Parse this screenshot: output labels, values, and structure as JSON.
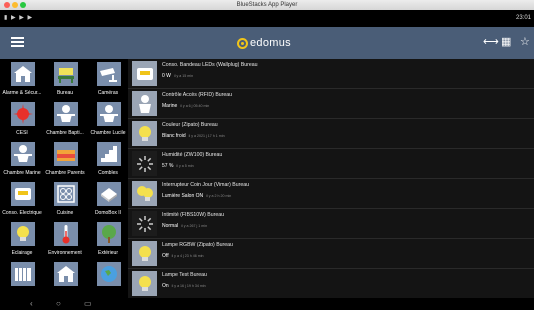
{
  "window": {
    "title": "BlueStacks App Player"
  },
  "status_bar": {
    "icons": "▮ ▶ ▶ ▶",
    "time": "23:01"
  },
  "app_bar": {
    "logo_text": "edomus"
  },
  "rooms": [
    {
      "label": "Alarme & Sécur...",
      "icon": "house-icon"
    },
    {
      "label": "Bureau",
      "icon": "desk-icon"
    },
    {
      "label": "Caméras",
      "icon": "camera-icon"
    },
    {
      "label": "CESI",
      "icon": "star-burst-icon"
    },
    {
      "label": "Chambre Bapti...",
      "icon": "baby-icon"
    },
    {
      "label": "Chambre Lucile",
      "icon": "baby-icon"
    },
    {
      "label": "Chambre Marine",
      "icon": "baby-icon"
    },
    {
      "label": "Chambre Parents",
      "icon": "bed-icon"
    },
    {
      "label": "Combles",
      "icon": "stairs-icon"
    },
    {
      "label": "Conso. Electrique",
      "icon": "meter-icon"
    },
    {
      "label": "Cuisine",
      "icon": "stove-icon"
    },
    {
      "label": "DomoBox II",
      "icon": "box-icon"
    },
    {
      "label": "Eclairage",
      "icon": "bulb-icon"
    },
    {
      "label": "Environnement",
      "icon": "thermometer-icon"
    },
    {
      "label": "Extérieur",
      "icon": "tree-icon"
    },
    {
      "label": "",
      "icon": "radiator-icon"
    },
    {
      "label": "",
      "icon": "house-icon"
    },
    {
      "label": "",
      "icon": "globe-icon"
    }
  ],
  "devices": [
    {
      "name": "Conso. Bandeau LEDs (Wallplug) Bureau",
      "value": "0 W",
      "ago": "il y a 15 min",
      "icon": "meter-icon"
    },
    {
      "name": "Contrôle Accès (RFID) Bureau",
      "value": "Marine",
      "ago": "il y a 6 j 05:40 min",
      "icon": "person-icon"
    },
    {
      "name": "Couleur (Zipato) Bureau",
      "value": "Blanc froid",
      "ago": "il y a 2021 j 17 h 1 min",
      "icon": "bulb-icon"
    },
    {
      "name": "Humidité (ZW100) Bureau",
      "value": "57 %",
      "ago": "il y a 5 min",
      "icon": "loading-icon"
    },
    {
      "name": "Interrupteur Coin Jour (Vimar) Bureau",
      "value": "Lumière Salon ON",
      "ago": "il y a 2 h 20 min",
      "icon": "bulb-pair-icon"
    },
    {
      "name": "Intimité (FIBS10W) Bureau",
      "value": "Normal",
      "ago": "il y a 267 j 1 min",
      "icon": "loading-icon"
    },
    {
      "name": "Lampe RGBW (Zipato) Bureau",
      "value": "Off",
      "ago": "il y a 4 j 23 h 46 min",
      "icon": "bulb-icon"
    },
    {
      "name": "Lampe Test Bureau",
      "value": "On",
      "ago": "il y a 16 j 19 h 34 min",
      "icon": "bulb-icon"
    }
  ],
  "colors": {
    "app_bar": "#4a5d77",
    "tile": "#7a8eab",
    "logo_accent": "#f0c419"
  }
}
